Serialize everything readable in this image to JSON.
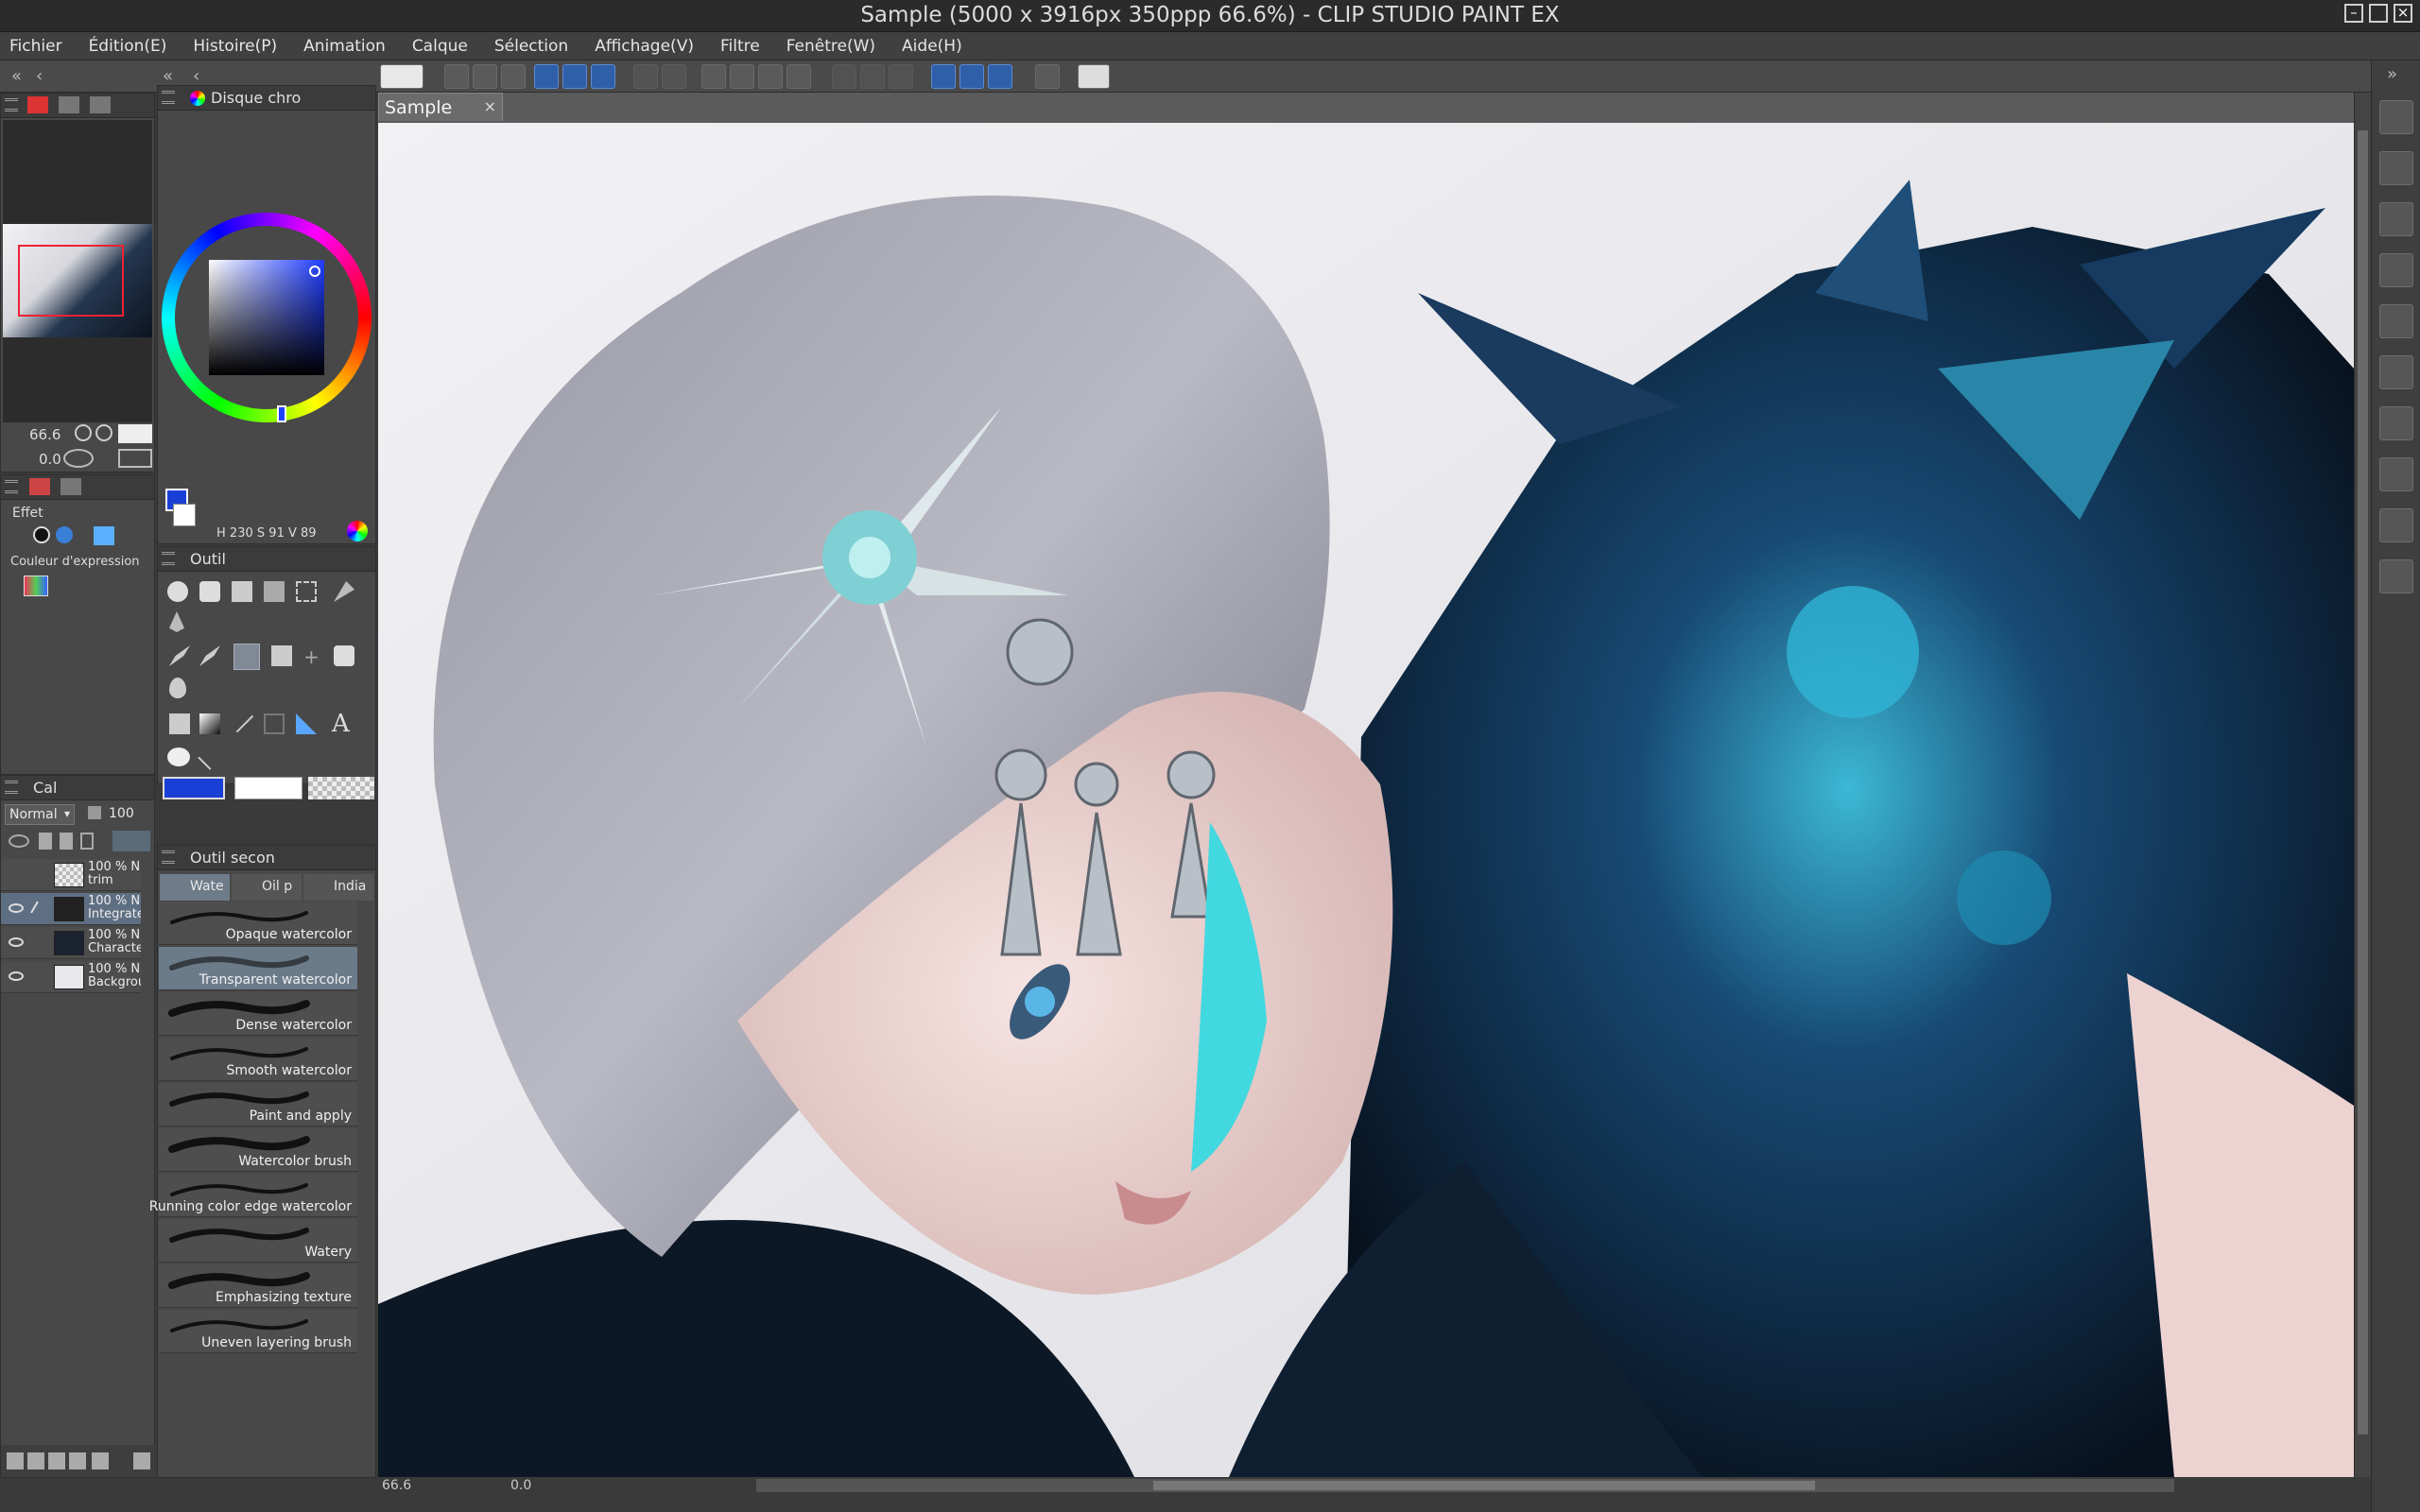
{
  "window": {
    "title": "Sample (5000 x 3916px 350ppp 66.6%)  - CLIP STUDIO PAINT EX"
  },
  "menu": [
    "Fichier",
    "Édition(E)",
    "Histoire(P)",
    "Animation",
    "Calque",
    "Sélection",
    "Affichage(V)",
    "Filtre",
    "Fenêtre(W)",
    "Aide(H)"
  ],
  "navigator": {
    "zoom": "66.6",
    "angle": "0.0"
  },
  "color_wheel": {
    "title": "Disque chro",
    "h": "230",
    "s": "91",
    "v": "89",
    "h_label": "H",
    "s_label": "S",
    "v_label": "V",
    "main_color": "#1a3fd6",
    "sub_color": "#ffffff"
  },
  "effect_panel": {
    "label": "Effet",
    "expression_label": "Couleur d'expression"
  },
  "tool_panel": {
    "title": "Outil"
  },
  "layers_panel": {
    "title": "Cal",
    "blend_mode": "Normal",
    "opacity": "100",
    "layers": [
      {
        "opacity": "100 % N",
        "name": "trim"
      },
      {
        "opacity": "100 % N",
        "name": "Integrate"
      },
      {
        "opacity": "100 % N",
        "name": "Character"
      },
      {
        "opacity": "100 % N",
        "name": "Backgrou"
      }
    ]
  },
  "sub_tool_panel": {
    "title": "Outil secon",
    "tabs": [
      "Wate",
      "Oil p",
      "India"
    ],
    "brushes": [
      "Opaque watercolor",
      "Transparent watercolor",
      "Dense watercolor",
      "Smooth watercolor",
      "Paint and apply",
      "Watercolor brush",
      "Running color edge watercolor",
      "Watery",
      "Emphasizing texture",
      "Uneven layering brush"
    ]
  },
  "canvas": {
    "tab_label": "Sample",
    "close": "×"
  },
  "status": {
    "zoom": "66.6",
    "angle": "0.0"
  }
}
